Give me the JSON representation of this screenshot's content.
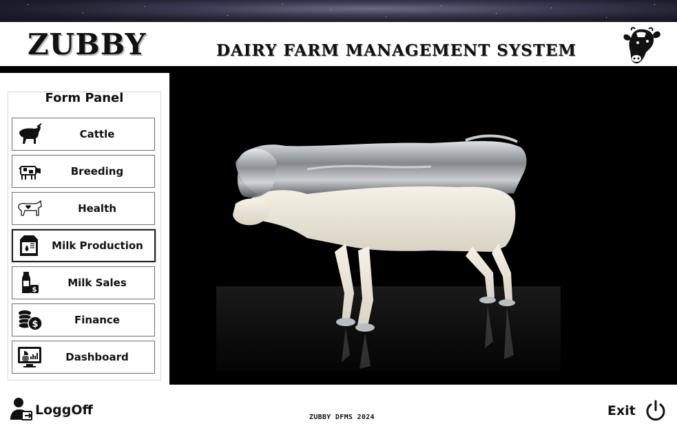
{
  "header": {
    "brand": "ZUBBY",
    "title": "DAIRY FARM MANAGEMENT SYSTEM",
    "logo_icon": "cow-head-icon"
  },
  "panel": {
    "title": "Form Panel",
    "items": [
      {
        "label": "Cattle",
        "icon": "bull-icon"
      },
      {
        "label": "Breeding",
        "icon": "cow-icon"
      },
      {
        "label": "Health",
        "icon": "cow-heart-icon"
      },
      {
        "label": "Milk Production",
        "icon": "milk-carton-icon"
      },
      {
        "label": "Milk Sales",
        "icon": "milk-bottle-dollar-icon"
      },
      {
        "label": "Finance",
        "icon": "coins-dollar-icon"
      },
      {
        "label": "Dashboard",
        "icon": "monitor-chart-icon"
      }
    ],
    "active_index": 3
  },
  "footer": {
    "logoff_label": "LoggOff",
    "credit": "ZUBBY DFMS 2024",
    "exit_label": "Exit"
  },
  "colors": {
    "background": "#ffffff",
    "media_background": "#000000",
    "text": "#111111"
  }
}
